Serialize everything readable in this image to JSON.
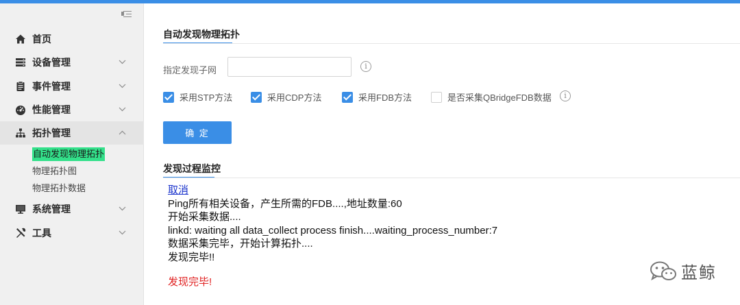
{
  "sidebar": {
    "items": [
      {
        "label": "首页",
        "icon": "home-icon",
        "expanded": null
      },
      {
        "label": "设备管理",
        "icon": "server-icon",
        "expanded": false
      },
      {
        "label": "事件管理",
        "icon": "clipboard-icon",
        "expanded": false
      },
      {
        "label": "性能管理",
        "icon": "dashboard-icon",
        "expanded": false
      },
      {
        "label": "拓扑管理",
        "icon": "topology-icon",
        "expanded": true
      },
      {
        "label": "系统管理",
        "icon": "monitor-icon",
        "expanded": false
      },
      {
        "label": "工具",
        "icon": "tools-icon",
        "expanded": false
      }
    ],
    "topology_sub": [
      {
        "label": "自动发现物理拓扑",
        "current": true
      },
      {
        "label": "物理拓扑图",
        "current": false
      },
      {
        "label": "物理拓扑数据",
        "current": false
      }
    ]
  },
  "main": {
    "title": "自动发现物理拓扑",
    "subnet": {
      "label": "指定发现子网",
      "value": "",
      "placeholder": ""
    },
    "options": [
      {
        "label": "采用STP方法",
        "checked": true
      },
      {
        "label": "采用CDP方法",
        "checked": true
      },
      {
        "label": "采用FDB方法",
        "checked": true
      },
      {
        "label": "是否采集QBridgeFDB数据",
        "checked": false
      }
    ],
    "confirm_label": "确 定",
    "monitor_title": "发现过程监控",
    "log": {
      "cancel": "取消",
      "lines": [
        "Ping所有相关设备，产生所需的FDB....,地址数量:60",
        "开始采集数据....",
        "linkd: waiting all data_collect process finish....waiting_process_number:7",
        "数据采集完毕，开始计算拓扑....",
        "发现完毕!!"
      ],
      "final": "发现完毕!"
    }
  },
  "watermark": {
    "text": "蓝鲸"
  },
  "colors": {
    "accent": "#3a8ee6",
    "highlight": "#33e08a",
    "error": "#e02020",
    "link": "#1a33cc"
  }
}
